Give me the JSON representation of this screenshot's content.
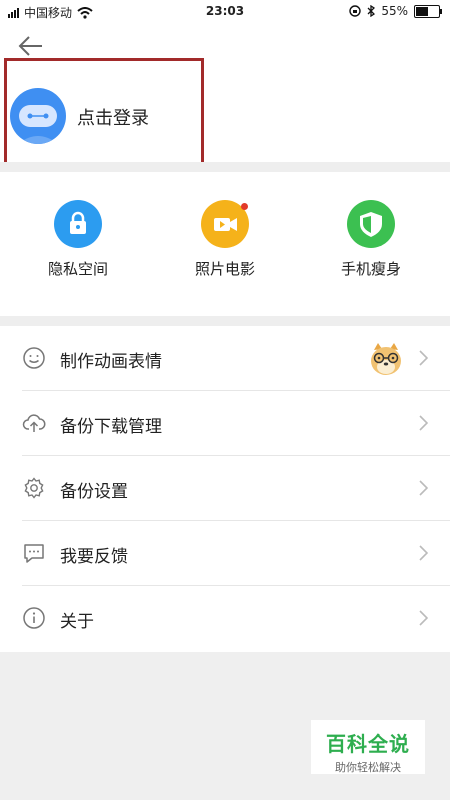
{
  "status_bar": {
    "carrier": "中国移动",
    "time": "23:03",
    "battery": "55%",
    "battery_level": 0.55
  },
  "header": {
    "login_text": "点击登录"
  },
  "quick_actions": [
    {
      "label": "隐私空间",
      "color": "#2c9cf0",
      "icon": "lock-icon"
    },
    {
      "label": "照片电影",
      "color": "#f5b21a",
      "icon": "video-camera-icon"
    },
    {
      "label": "手机瘦身",
      "color": "#3cc051",
      "icon": "shield-icon"
    }
  ],
  "menu": [
    {
      "label": "制作动画表情",
      "icon": "smiley-icon"
    },
    {
      "label": "备份下载管理",
      "icon": "cloud-upload-icon"
    },
    {
      "label": "备份设置",
      "icon": "gear-icon"
    },
    {
      "label": "我要反馈",
      "icon": "message-icon"
    },
    {
      "label": "关于",
      "icon": "info-icon"
    }
  ],
  "watermark": {
    "title": "百科全说",
    "subtitle": "助你轻松解决"
  },
  "colors": {
    "avatar": "#3f8ff2",
    "highlight_border": "#a22a2a",
    "watermark_green": "#2eae4f"
  }
}
